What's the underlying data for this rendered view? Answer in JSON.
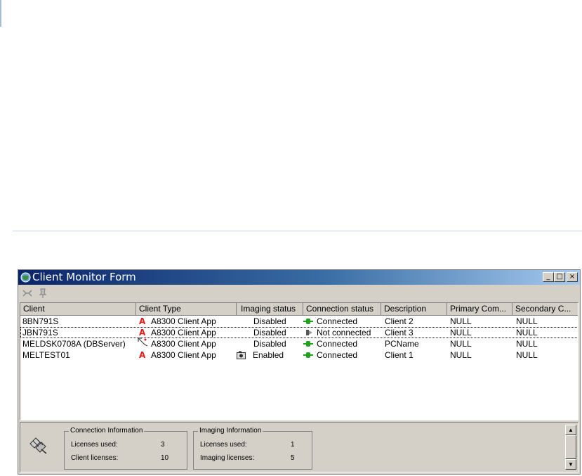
{
  "window": {
    "title": "Client Monitor Form",
    "buttons": {
      "minimize": "_",
      "maximize": "□",
      "close": "×"
    }
  },
  "toolbar": {
    "items": [
      {
        "icon": "connect-clients-icon"
      },
      {
        "icon": "pin-icon"
      }
    ]
  },
  "table": {
    "columns": [
      "Client",
      "Client Type",
      "Imaging status",
      "Connection status",
      "Description",
      "Primary Com...",
      "Secondary C..."
    ],
    "rows": [
      {
        "client": "8BN791S",
        "type_icon": "app-a-icon",
        "type": "A8300 Client App",
        "imaging_icon": "",
        "imaging": "Disabled",
        "conn_icon": "connected-icon",
        "connection": "Connected",
        "description": "Client 2",
        "primary": "NULL",
        "secondary": "NULL"
      },
      {
        "client": "JBN791S",
        "type_icon": "app-a-icon",
        "type": "A8300 Client App",
        "imaging_icon": "",
        "imaging": "Disabled",
        "conn_icon": "not-connected-icon",
        "connection": "Not connected",
        "description": "Client 3",
        "primary": "NULL",
        "secondary": "NULL"
      },
      {
        "client": "MELDSK0708A (DBServer)",
        "type_icon": "server-icon",
        "type": "A8300 Client App",
        "imaging_icon": "",
        "imaging": "Disabled",
        "conn_icon": "connected-icon",
        "connection": "Connected",
        "description": "PCName",
        "primary": "NULL",
        "secondary": "NULL"
      },
      {
        "client": "MELTEST01",
        "type_icon": "app-a-icon",
        "type": "A8300 Client App",
        "imaging_icon": "camera-icon",
        "imaging": "Enabled",
        "conn_icon": "connected-icon",
        "connection": "Connected",
        "description": "Client 1",
        "primary": "NULL",
        "secondary": "NULL"
      }
    ]
  },
  "connection_info": {
    "title": "Connection Information",
    "licenses_used_label": "Licenses used:",
    "licenses_used": "3",
    "client_licenses_label": "Client licenses:",
    "client_licenses": "10"
  },
  "imaging_info": {
    "title": "Imaging Information",
    "licenses_used_label": "Licenses used:",
    "licenses_used": "1",
    "imaging_licenses_label": "Imaging licenses:",
    "imaging_licenses": "5"
  },
  "colors": {
    "title_gradient_start": "#0a246a",
    "title_gradient_end": "#a6caf0",
    "connected": "#1fa31f",
    "app_icon_red": "#e21b1b"
  }
}
